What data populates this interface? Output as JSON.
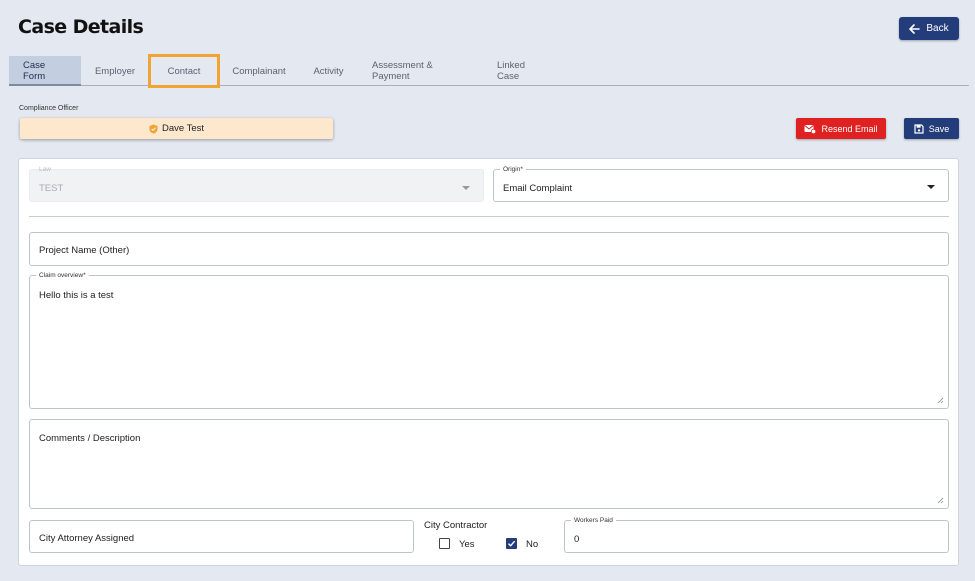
{
  "page": {
    "title": "Case Details"
  },
  "header": {
    "back_label": "Back"
  },
  "tabs": [
    {
      "label": "Case Form",
      "active": true
    },
    {
      "label": "Employer"
    },
    {
      "label": "Contact",
      "highlighted": true
    },
    {
      "label": "Complainant"
    },
    {
      "label": "Activity"
    },
    {
      "label": "Assessment & Payment"
    },
    {
      "label": "Linked Case"
    }
  ],
  "officer": {
    "label": "Compliance Officer",
    "name": "Dave Test"
  },
  "actions": {
    "resend_label": "Resend Email",
    "save_label": "Save"
  },
  "form": {
    "law": {
      "label": "Law",
      "value": "TEST"
    },
    "origin": {
      "label": "Origin*",
      "value": "Email Complaint"
    },
    "project_name": {
      "placeholder": "Project Name (Other)"
    },
    "claim_overview": {
      "label": "Claim overview*",
      "value": "Hello this is a test"
    },
    "comments": {
      "placeholder": "Comments / Description"
    },
    "attorney": {
      "placeholder": "City Attorney Assigned"
    },
    "city_contractor": {
      "label": "City Contractor",
      "yes_label": "Yes",
      "yes_checked": false,
      "no_label": "No",
      "no_checked": true
    },
    "workers_paid": {
      "label": "Workers Paid",
      "value": "0"
    }
  },
  "colors": {
    "primary": "#233d7b",
    "danger": "#e02121",
    "officer_bg": "#fde8cd",
    "highlight": "#f0a533",
    "background": "#e4e8f0"
  }
}
